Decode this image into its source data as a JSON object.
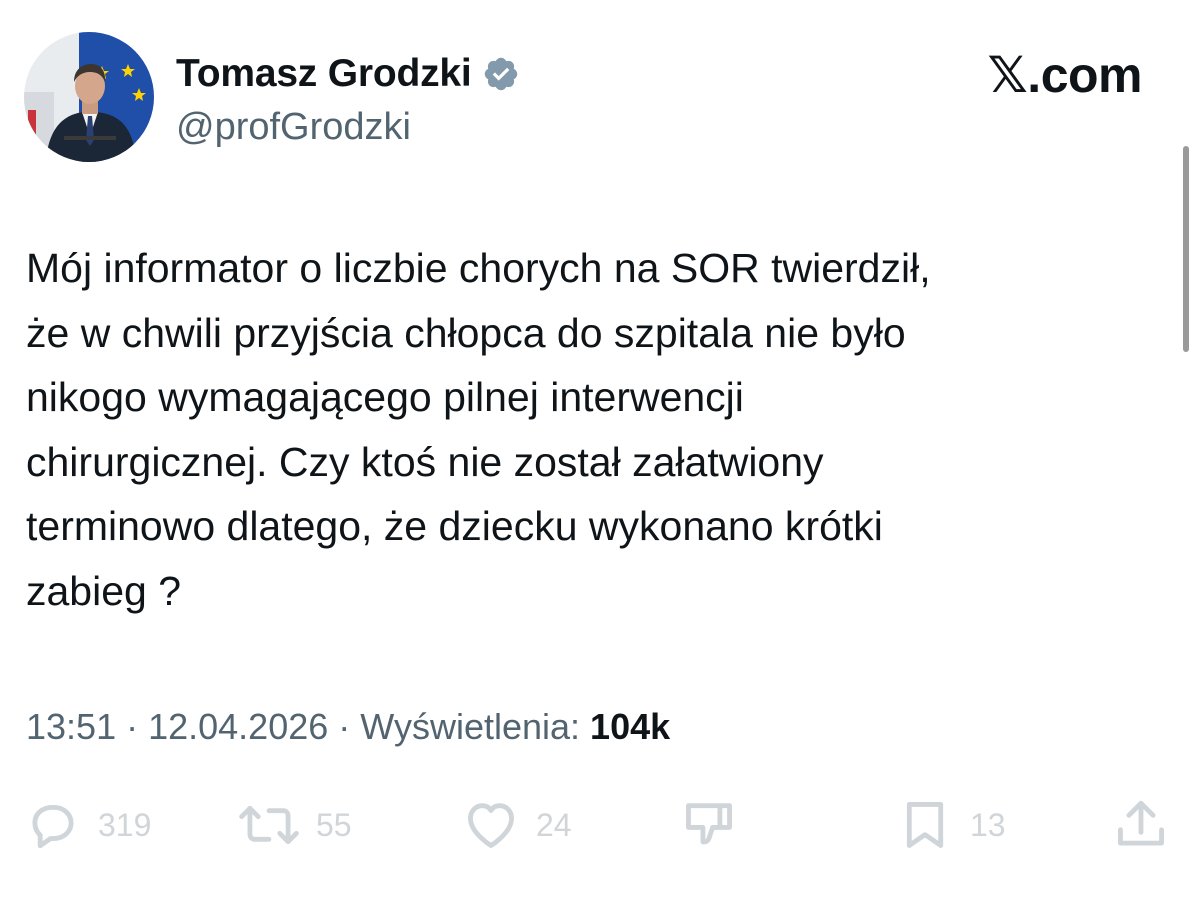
{
  "author": {
    "display_name": "Tomasz Grodzki",
    "handle": "@profGrodzki",
    "verified_icon": "verified-badge-icon",
    "avatar": "avatar-photo"
  },
  "brand": {
    "label": "𝕏.com"
  },
  "tweet": {
    "text": "Mój informator o liczbie chorych na SOR twierdził,\nże w chwili przyjścia chłopca do szpitala nie było\nnikogo wymagającego pilnej interwencji\nchirurgicznej. Czy ktoś nie został załatwiony\nterminowo dlatego, że dziecku wykonano krótki\nzabieg ?",
    "time": "13:51",
    "separator": " · ",
    "date": "12.04.2026",
    "views_label": "Wyświetlenia:",
    "views_count": "104k"
  },
  "actions": {
    "reply": {
      "icon": "reply-icon",
      "count": "319"
    },
    "repost": {
      "icon": "repost-icon",
      "count": "55"
    },
    "like": {
      "icon": "heart-icon",
      "count": "24"
    },
    "dislike": {
      "icon": "dislike-icon"
    },
    "bookmark": {
      "icon": "bookmark-icon",
      "count": "13"
    },
    "share": {
      "icon": "share-icon"
    }
  },
  "colors": {
    "text": "#0f1419",
    "secondary": "#536471",
    "verified": "#829aab",
    "action_faded": "#d0d5d9"
  }
}
